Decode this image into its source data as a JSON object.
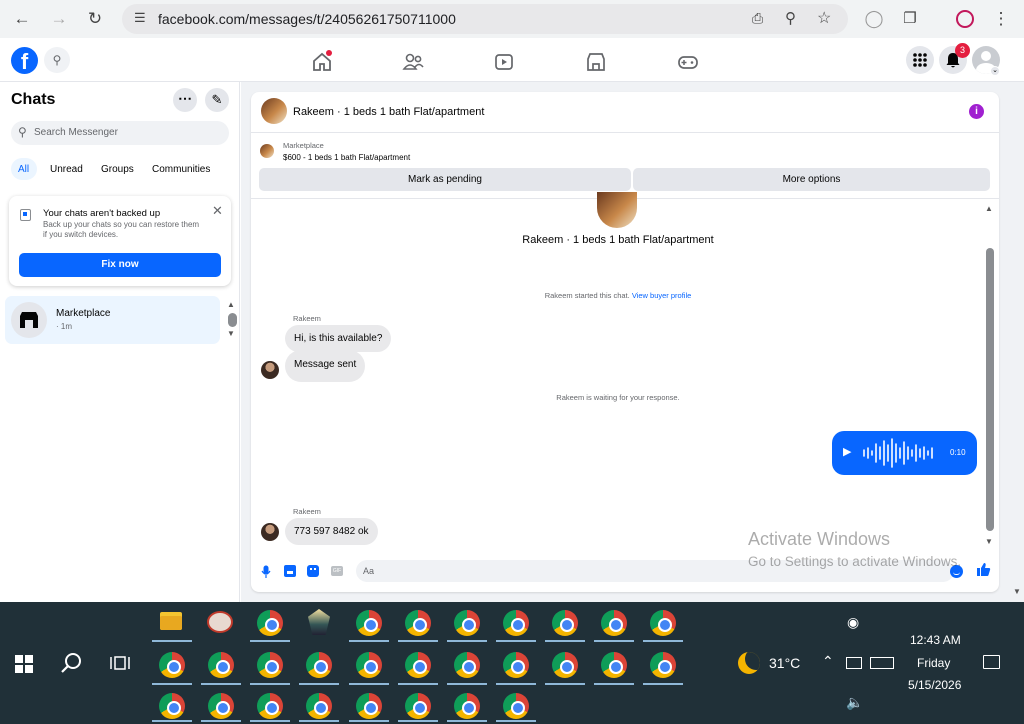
{
  "browser": {
    "url": "facebook.com/messages/t/24056261750711000"
  },
  "fb": {
    "notif_count": "3"
  },
  "sidebar": {
    "title": "Chats",
    "search_placeholder": "Search Messenger",
    "filters": [
      "All",
      "Unread",
      "Groups",
      "Communities"
    ],
    "backup": {
      "title": "Your chats aren't backed up",
      "body": "Back up your chats so you can restore them if you switch devices.",
      "button": "Fix now"
    },
    "chat": {
      "name": "Marketplace",
      "time": "· 1m"
    }
  },
  "conversation": {
    "title": "Rakeem · 1 beds 1 bath Flat/apartment",
    "listing_source": "Marketplace",
    "listing_desc": "$600 - 1 beds 1 bath Flat/apartment",
    "mark_pending": "Mark as pending",
    "more_options": "More options",
    "hero_title": "Rakeem · 1 beds 1 bath Flat/apartment",
    "started_text": "Rakeem started this chat.",
    "view_profile": "View buyer profile",
    "sender1": "Rakeem",
    "msg1": "Hi, is this available?",
    "msg2": "Message sent",
    "waiting": "Rakeem is waiting for your response.",
    "voice_duration": "0:10",
    "sender2": "Rakeem",
    "msg3": "773 597 8482 ok",
    "composer_placeholder": "Aa"
  },
  "watermark": {
    "line1": "Activate Windows",
    "line2": "Go to Settings to activate Windows."
  },
  "taskbar": {
    "temp": "31°C",
    "time": "12:43 AM",
    "day": "Friday",
    "date": "5/15/2026"
  },
  "colors": {
    "accent": "#0866ff",
    "purple": "#a020d0",
    "taskbar": "#203038"
  }
}
